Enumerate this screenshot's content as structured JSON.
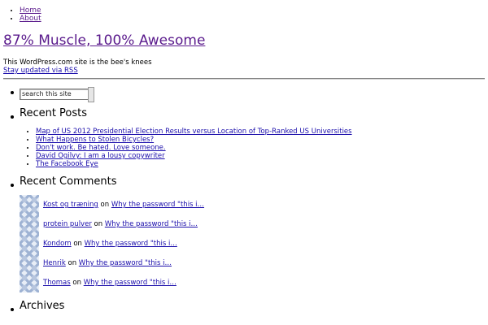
{
  "nav": {
    "items": [
      {
        "label": "Home"
      },
      {
        "label": "About"
      }
    ]
  },
  "site": {
    "title": "87% Muscle, 100% Awesome",
    "tagline": "This WordPress.com site is the bee's knees",
    "rss_link": "Stay updated via RSS"
  },
  "search": {
    "placeholder": "search this site"
  },
  "recent_posts": {
    "title": "Recent Posts",
    "items": [
      "Map of US 2012 Presidential Election Results versus Location of Top-Ranked US Universities",
      "What Happens to Stolen Bicycles?",
      "Don't work. Be hated. Love someone.",
      "David Ogilvy: I am a lousy copywriter",
      "The Facebook Eye"
    ]
  },
  "recent_comments": {
    "title": "Recent Comments",
    "on_word": "on",
    "items": [
      {
        "author": "Kost og træning",
        "post": "Why the password \"this i…"
      },
      {
        "author": "protein pulver",
        "post": "Why the password \"this i…"
      },
      {
        "author": "Kondom",
        "post": "Why the password \"this i…"
      },
      {
        "author": "Henrik",
        "post": "Why the password \"this i…"
      },
      {
        "author": "Thomas",
        "post": "Why the password \"this i…"
      }
    ]
  },
  "archives": {
    "title": "Archives"
  }
}
